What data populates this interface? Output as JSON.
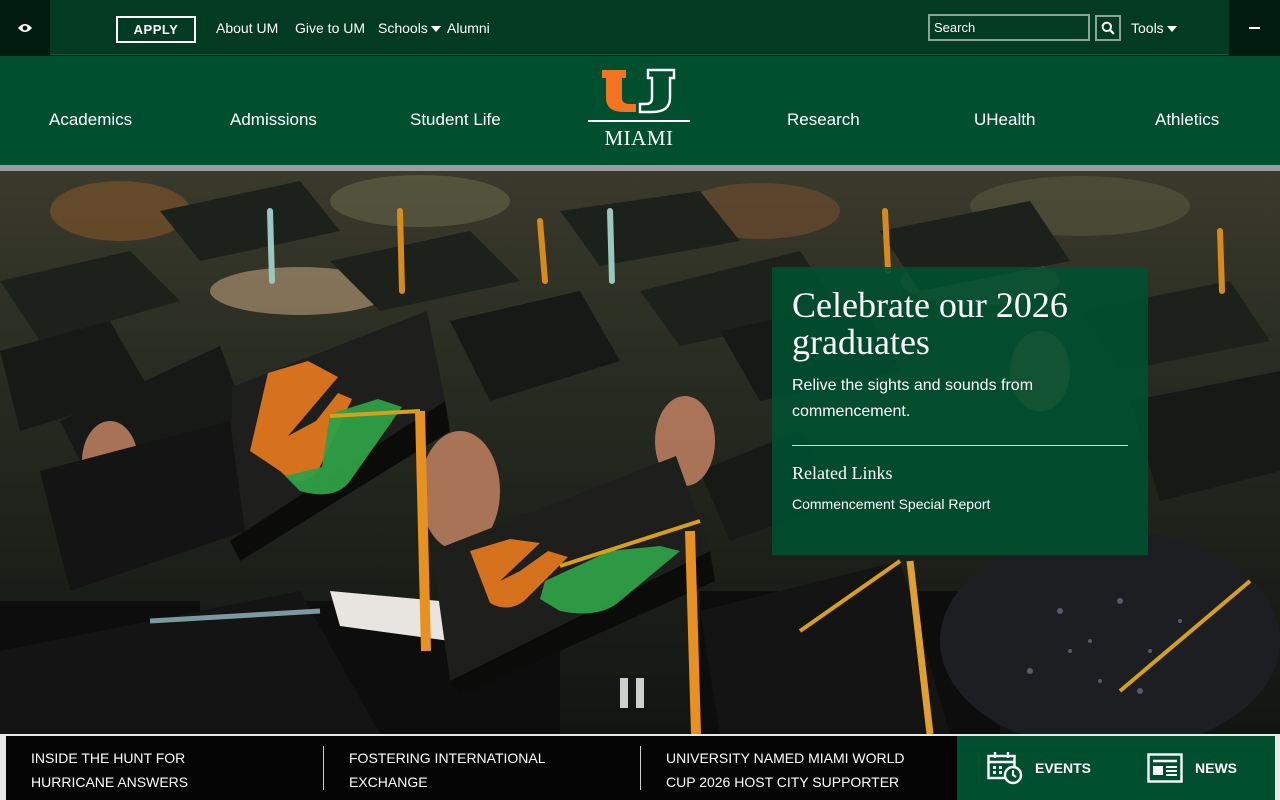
{
  "topbar": {
    "apply_label": "APPLY",
    "links": [
      "About UM",
      "Give to UM",
      "Schools",
      "Alumni"
    ],
    "search_placeholder": "Search",
    "tools_label": "Tools"
  },
  "mainnav": {
    "items": [
      "Academics",
      "Admissions",
      "Student Life",
      "Research",
      "UHealth",
      "Athletics"
    ],
    "logo_text": "MIAMI"
  },
  "hero": {
    "title": "Celebrate our 2026 graduates",
    "description": "Relive the sights and sounds from commencement.",
    "related_heading": "Related Links",
    "related_links": [
      "Commencement Special Report"
    ]
  },
  "bottom": {
    "news": [
      "Inside the Hunt for Hurricane Answers",
      "Fostering International Exchange",
      "University Named Miami World Cup 2026 Host City Supporter"
    ],
    "quick_links": [
      "EVENTS",
      "NEWS"
    ]
  },
  "colors": {
    "brand_green": "#005030",
    "brand_orange": "#F47321",
    "topbar_dark": "#033a22"
  }
}
